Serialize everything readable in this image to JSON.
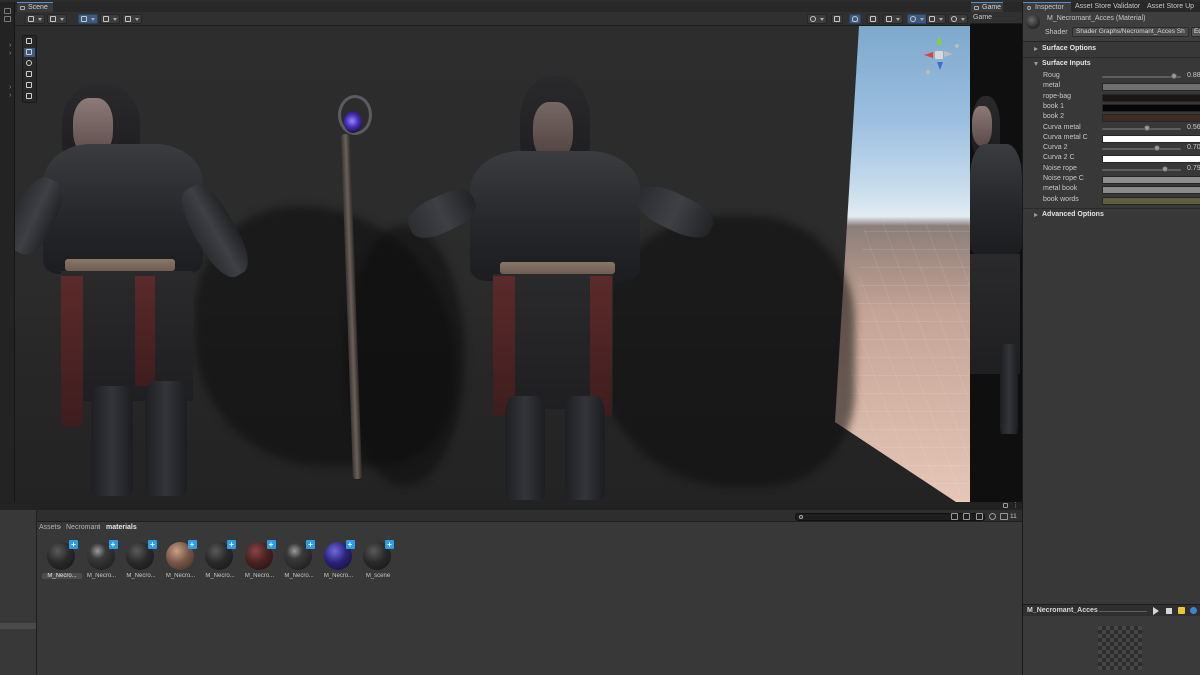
{
  "scene": {
    "tab_label": "Scene"
  },
  "game": {
    "tab_label": "Game",
    "display_label": "Game"
  },
  "inspector": {
    "tabs": [
      {
        "label": "Inspector"
      },
      {
        "label": "Asset Store Validator"
      },
      {
        "label": "Asset Store Up"
      }
    ],
    "material_name": "M_Necromant_Acces (Material)",
    "shader_label": "Shader",
    "shader_value": "Shader Graphs/Necromant_Acces Sh",
    "edit_label": "Ed",
    "sections": {
      "surface_options": "Surface Options",
      "surface_inputs": "Surface Inputs",
      "advanced_options": "Advanced Options"
    },
    "properties": [
      {
        "label": "Roug",
        "kind": "slider",
        "value": "0.88",
        "fraction": 0.92
      },
      {
        "label": "metal",
        "kind": "color",
        "color": "#6f6f6f"
      },
      {
        "label": "rope-bag",
        "kind": "color",
        "color": "#1a1714"
      },
      {
        "label": "book 1",
        "kind": "color",
        "color": "#050505"
      },
      {
        "label": "book 2",
        "kind": "color",
        "color": "#3f2c22"
      },
      {
        "label": "Curva metal",
        "kind": "slider",
        "value": "0.56",
        "fraction": 0.58
      },
      {
        "label": "Curva metal C",
        "kind": "color",
        "color": "#ffffff"
      },
      {
        "label": "Curva 2",
        "kind": "slider",
        "value": "0.70",
        "fraction": 0.71
      },
      {
        "label": "Curva 2 C",
        "kind": "color",
        "color": "#ffffff"
      },
      {
        "label": "Noise rope",
        "kind": "slider",
        "value": "0.79",
        "fraction": 0.81
      },
      {
        "label": "Noise rope C",
        "kind": "color",
        "color": "#8e8e8e"
      },
      {
        "label": "metal book",
        "kind": "color",
        "color": "#8a8a8a"
      },
      {
        "label": "book words",
        "kind": "color",
        "color": "#5f5e40"
      }
    ],
    "preview_name": "M_Necromant_Acces"
  },
  "project": {
    "breadcrumb": [
      "Assets",
      "Necromant",
      "materials"
    ],
    "asset_count": "11",
    "assets": [
      {
        "name": "M_Necro...",
        "tone": "dark",
        "selected": true
      },
      {
        "name": "M_Necro...",
        "tone": "dark-spec",
        "selected": false
      },
      {
        "name": "M_Necro...",
        "tone": "dark",
        "selected": false
      },
      {
        "name": "M_Necro...",
        "tone": "skin",
        "selected": false
      },
      {
        "name": "M_Necro...",
        "tone": "dark",
        "selected": false
      },
      {
        "name": "M_Necro...",
        "tone": "red",
        "selected": false
      },
      {
        "name": "M_Necro...",
        "tone": "dark-spec",
        "selected": false
      },
      {
        "name": "M_Necro...",
        "tone": "blue",
        "selected": false
      },
      {
        "name": "M_scene",
        "tone": "dark",
        "selected": false
      }
    ]
  },
  "colors": {
    "accent": "#4f8fd6",
    "active_tool": "#3d5a7e",
    "asset_plus": "#2f9ce8"
  }
}
